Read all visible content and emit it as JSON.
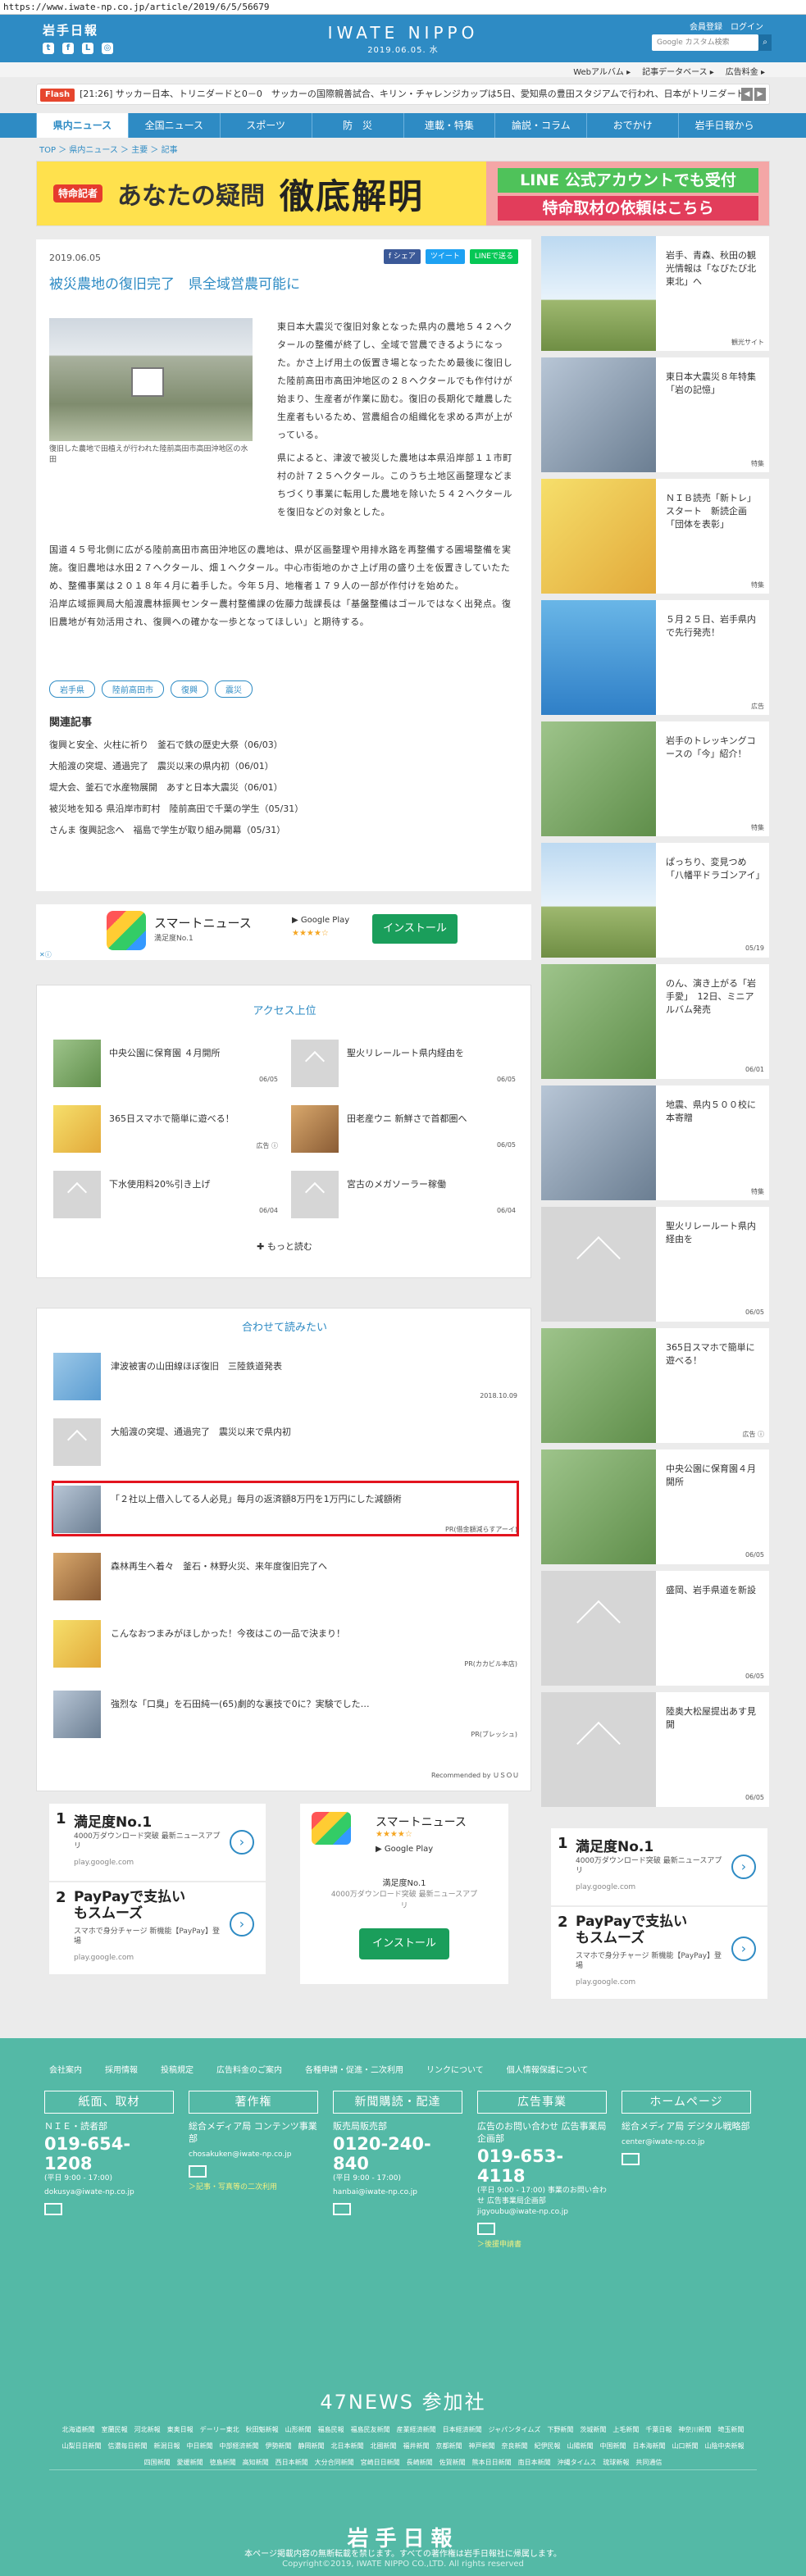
{
  "url": "https://www.iwate-np.co.jp/article/2019/6/5/56679",
  "header": {
    "logo": "岩手日報",
    "brand": "IWATE NIPPO",
    "date": "2019.06.05. 水",
    "member": "会員登録　ログイン",
    "search_placeholder": "Google カスタム検索"
  },
  "service_links": [
    "Webアルバム ▸",
    "記事データベース ▸",
    "広告料金 ▸"
  ],
  "flash": {
    "label": "Flash",
    "text": "[21:26] サッカー日本、トリニダードと0－0　サッカーの国際親善試合、キリン・チャレンジカップは5日、愛知県の豊田スタジアムで行われ、日本がトリニダード・"
  },
  "nav": [
    "県内ニュース",
    "全国ニュース",
    "スポーツ",
    "防　災",
    "連載・特集",
    "論説・コラム",
    "おでかけ",
    "岩手日報から"
  ],
  "breadcrumb": "TOP ＞ 県内ニュース ＞ 主要 ＞ 記事",
  "banner": {
    "tag": "特命記者",
    "question": "あなたの疑問",
    "big": "徹底解明",
    "line1": "LINE 公式アカウントでも受付",
    "line2": "特命取材の依頼はこちら"
  },
  "article": {
    "date": "2019.06.05",
    "share_fb": "f シェア",
    "share_tw": "ツイート",
    "share_line": "LINEで送る",
    "title": "被災農地の復旧完了　県全域営農可能に",
    "caption": "復旧した農地で田植えが行われた陸前高田市高田沖地区の水田",
    "p1": "東日本大震災で復旧対象となった県内の農地５４２ヘクタールの整備が終了し、全域で営農できるようになった。かさ上げ用土の仮置き場となったため最後に復旧した陸前高田市高田沖地区の２８ヘクタールでも作付けが始まり、生産者が作業に励む。復旧の長期化で離農した生産者もいるため、営農組合の組織化を求める声が上がっている。",
    "p2": "県によると、津波で被災した農地は本県沿岸部１１市町村の計７２５ヘクタール。このうち土地区画整理などまちづくり事業に転用した農地を除いた５４２ヘクタールを復旧などの対象とした。",
    "p3": "国道４５号北側に広がる陸前高田市高田沖地区の農地は、県が区画整理や用排水路を再整備する圃場整備を実施。復旧農地は水田２７ヘクタール、畑１ヘクタール。中心市街地のかさ上げ用の盛り土を仮置きしていたため、整備事業は２０１８年４月に着手した。今年５月、地権者１７９人の一部が作付けを始めた。",
    "p4": "沿岸広域振興局大船渡農林振興センター農村整備課の佐藤力哉課長は「基盤整備はゴールではなく出発点。復旧農地が有効活用され、復興への確かな一歩となってほしい」と期待する。",
    "tags": [
      "岩手県",
      "陸前高田市",
      "復興",
      "震災"
    ],
    "related_head": "関連記事",
    "related": [
      "復興と安全、火柱に祈り　釜石で鉄の歴史大祭（06/03）",
      "大船渡の突堤、通過完了　震災以来の県内初（06/01）",
      "堤大会、釜石で水産物展開　あすと日本大震災（06/01）",
      "被災地を知る 県沿岸市町村　陸前高田で千葉の学生（05/31）",
      "さんま 復興記念へ　福島で学生が取り組み開幕（05/31）"
    ]
  },
  "app_banner": {
    "name": "スマートニュース",
    "sub": "満足度No.1",
    "gplay": "▶ Google Play",
    "stars": "★★★★☆",
    "install": "インストール",
    "adchoice": "✕ⓘ"
  },
  "ranking": {
    "title": "アクセス上位",
    "items": [
      {
        "title": "中央公園に保育園 ４月開所",
        "date": "06/05"
      },
      {
        "title": "聖火リレールート県内経由を",
        "date": "06/05"
      },
      {
        "title": "365日スマホで簡単に遊べる！",
        "date": "広告 ⓘ"
      },
      {
        "title": "田老産ウニ 新鮮さで首都圏へ",
        "date": "06/05"
      },
      {
        "title": "下水使用料20%引き上げ",
        "date": "06/04"
      },
      {
        "title": "宮古のメガソーラー稼働",
        "date": "06/04"
      }
    ],
    "more": "✚ もっと読む"
  },
  "recommend": {
    "title": "合わせて読みたい",
    "items": [
      {
        "title": "津波被害の山田線ほぼ復旧　三陸鉄道発表",
        "sub": "2018.10.09"
      },
      {
        "title": "大船渡の突堤、通過完了　震災以来で県内初",
        "sub": ""
      },
      {
        "title": "「２社以上借入してる人必見」毎月の返済額8万円を1万円にした減額術",
        "sub": "PR(借金額減らすアーイ)"
      },
      {
        "title": "森林再生へ着々　釜石・林野火災、来年度復旧完了へ",
        "sub": ""
      },
      {
        "title": "こんなおつまみがほしかった！今夜はこの一品で決まり！",
        "sub": "PR(カカビル本店)"
      },
      {
        "title": "強烈な「口臭」を石田純一(65)劇的な裏技で0に？実験でした…",
        "sub": "PR(ブレッシュ)"
      }
    ],
    "footer": "Recommended by ＵＳＯＵ"
  },
  "ads": [
    {
      "num": "1",
      "head": "満足度No.1",
      "desc": "4000万ダウンロード突破 最新ニュースアプリ",
      "domain": "play.google.com"
    },
    {
      "num": "2",
      "head": "PayPayで支払いもスムーズ",
      "desc": "スマホで身分チャージ 新機能【PayPay】登場",
      "domain": "play.google.com"
    }
  ],
  "ad_big": {
    "name": "スマートニュース",
    "stars": "★★★★☆",
    "gplay": "▶ Google Play",
    "s1": "満足度No.1",
    "s2": "4000万ダウンロード突破 最新ニュースアプリ",
    "btn": "インストール"
  },
  "sidebar": [
    {
      "title": "岩手、青森、秋田の観光情報は「なびたび北東北」へ",
      "date": "観光サイト"
    },
    {
      "title": "東日本大震災８年特集「岩の記憶」",
      "date": "特集"
    },
    {
      "title": "ＮＩＢ読売「新トレ」スタート　新読企画「団体を表彰」",
      "date": "特集"
    },
    {
      "title": "５月２５日、岩手県内で先行発売！",
      "date": "広告"
    },
    {
      "title": "岩手のトレッキングコースの「今」紹介！",
      "date": "特集"
    },
    {
      "title": "ぱっちり、変見つめ「八幡平ドラゴンアイ」",
      "date": "05/19"
    },
    {
      "title": "のん、演き上がる「岩手愛」　12日、ミニアルバム発売",
      "date": "06/01"
    },
    {
      "title": "地震、県内５００校に本寄贈",
      "date": "特集"
    },
    {
      "title": "聖火リレールート県内経由を",
      "date": "06/05"
    },
    {
      "title": "365日スマホで簡単に遊べる！",
      "date": "広告 ⓘ"
    },
    {
      "title": "中央公園に保育園４月開所",
      "date": "06/05"
    },
    {
      "title": "盛岡、岩手県道を新設",
      "date": "06/05"
    },
    {
      "title": "陸奥大松屋提出あす見開",
      "date": "06/05"
    }
  ],
  "footer": {
    "links": [
      "会社案内",
      "採用情報",
      "投稿規定",
      "広告料金のご案内",
      "各種申請・促進・二次利用",
      "リンクについて",
      "個人情報保護について"
    ],
    "cols": [
      {
        "head": "紙面、取材",
        "l1": "ＮＩＥ・読者部",
        "tel": "019-654-1208",
        "sm": "(平日 9:00 - 17:00)",
        "mail_text": "dokusya@iwate-np.co.jp",
        "lnk": ""
      },
      {
        "head": "著作権",
        "l1": "総合メディア局 コンテンツ事業部",
        "tel": "",
        "sm": "",
        "mail_text": "chosakuken@iwate-np.co.jp",
        "lnk": "＞記事・写真等の二次利用"
      },
      {
        "head": "新聞購読・配達",
        "l1": "販売局販売部",
        "tel": "0120-240-840",
        "sm": "(平日 9:00 - 17:00)",
        "mail_text": "hanbai@iwate-np.co.jp",
        "lnk": ""
      },
      {
        "head": "広告事業",
        "l1": "広告のお問い合わせ 広告事業局企画部",
        "tel": "019-653-4118",
        "sm": "(平日 9:00 - 17:00) 事業のお問い合わせ 広告事業局企画部 jigyoubu@iwate-np.co.jp",
        "mail_text": "",
        "lnk": "＞後援申請書"
      },
      {
        "head": "ホームページ",
        "l1": "総合メディア局 デジタル戦略部",
        "tel": "",
        "sm": "",
        "mail_text": "center@iwate-np.co.jp",
        "lnk": ""
      }
    ],
    "network": "47NEWS 参加社",
    "papers": "北海道新聞　室蘭民報　河北新報　東奥日報　デーリー東北　秋田魁新報　山形新聞　福島民報　福島民友新聞　産業経済新聞　日本経済新聞　ジャパンタイムズ　下野新聞　茨城新聞　上毛新聞　千葉日報　神奈川新聞　埼玉新聞　山梨日日新聞　信濃毎日新聞　新潟日報　中日新聞　中部経済新聞　伊勢新聞　静岡新聞　北日本新聞　北國新聞　福井新聞　京都新聞　神戸新聞　奈良新聞　紀伊民報　山陽新聞　中国新聞　日本海新聞　山口新聞　山陰中央新報　四国新聞　愛媛新聞　徳島新聞　高知新聞　西日本新聞　大分合同新聞　宮崎日日新聞　長崎新聞　佐賀新聞　熊本日日新聞　南日本新聞　沖縄タイムス　琉球新報　共同通信",
    "logo": "岩手日報",
    "note": "本ページ掲載内容の無断転載を禁じます。すべての著作権は岩手日報社に帰属します。",
    "copy": "Copyright©2019, IWATE NIPPO CO.,LTD. All rights reserved"
  }
}
